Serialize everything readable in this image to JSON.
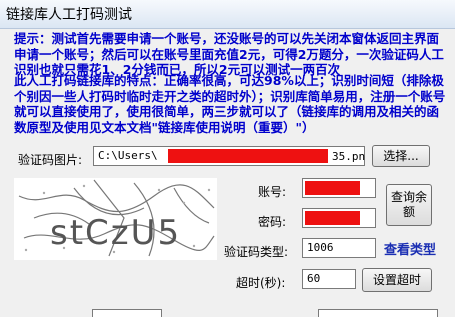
{
  "window": {
    "title": "链接库人工打码测试"
  },
  "tips": {
    "notice": "提示：测试首先需要申请一个账号，还没账号的可以先关闭本窗体返回主界面申请一个账号；然后可以在账号里面充值2元，可得2万题分，一次验证码人工识别也就只需花1、2分钱而已，所以2元可以测试一两百次",
    "features": "此人工打码链接库的特点：正确率很高，可达98%以上；识别时间短（排除极个别因一些人打码时临时走开之类的超时外）；识别库简单易用，注册一个账号就可以直接使用了，使用很简单，两三步就可以了（链接库的调用及相关的函数原型及使用见文本文档\"链接库使用说明（重要）\"）"
  },
  "form": {
    "image_label": "验证码图片:",
    "image_path_prefix": "C:\\Users\\",
    "image_path_suffix": "35.pn",
    "browse_button": "选择...",
    "account_label": "账号:",
    "password_label": "密码:",
    "query_button": "查询余额",
    "type_label": "验证码类型:",
    "type_value": "1006",
    "view_types_link": "查看类型",
    "timeout_label": "超时(秒):",
    "timeout_value": "60",
    "set_timeout_button": "设置超时"
  },
  "captcha": {
    "text": "stCzU5"
  },
  "colors": {
    "tip_text": "#0000cc",
    "redaction": "#ee1111",
    "link": "#1b2fb3"
  }
}
